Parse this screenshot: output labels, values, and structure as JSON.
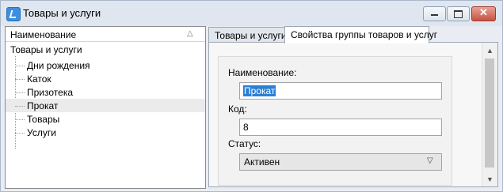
{
  "window": {
    "title": "Товары и услуги"
  },
  "left": {
    "column_header": "Наименование",
    "root": "Товары и услуги",
    "items": [
      "Дни рождения",
      "Каток",
      "Призотека",
      "Прокат",
      "Товары",
      "Услуги"
    ],
    "selected_index": 3
  },
  "tabs": [
    {
      "label": "Товары и услуги",
      "active": false
    },
    {
      "label": "Свойства группы товаров и услуг",
      "active": true
    }
  ],
  "form": {
    "name_label": "Наименование:",
    "name_value": "Прокат",
    "code_label": "Код:",
    "code_value": "8",
    "status_label": "Статус:",
    "status_value": "Активен"
  },
  "icons": {
    "app": "app-icon",
    "minimize": "minimize-icon",
    "maximize": "maximize-icon",
    "close": "close-icon",
    "sort": "sort-up-icon",
    "scroll_up": "scroll-up-icon",
    "scroll_down": "scroll-down-icon",
    "dropdown": "chevron-down-icon"
  },
  "colors": {
    "close_button": "#c65342",
    "selection": "#2a7fd6",
    "titlebar": "#dfe6ef"
  }
}
